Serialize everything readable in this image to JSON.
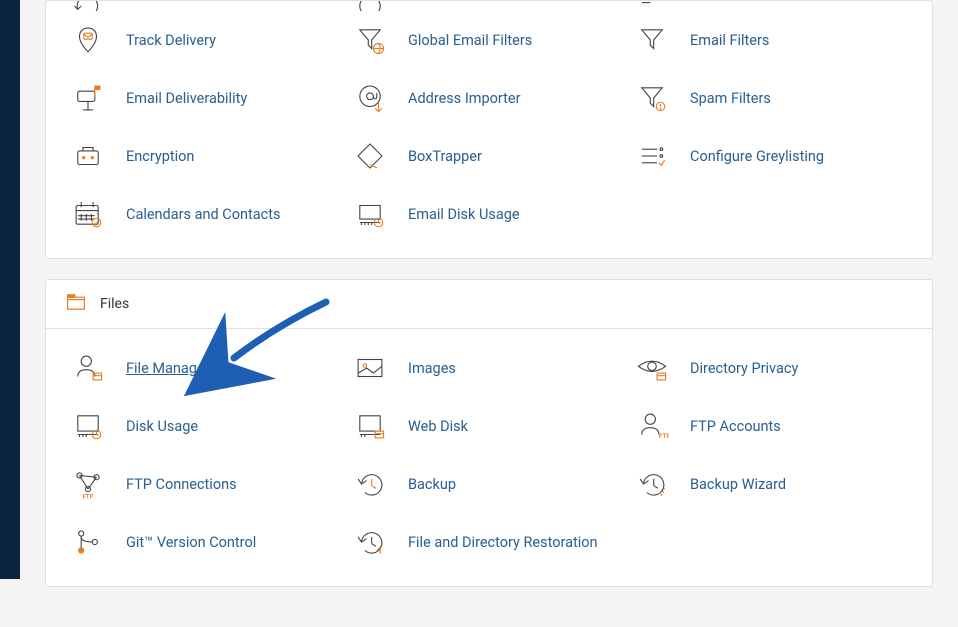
{
  "email": {
    "items": [
      {
        "label": "Track Delivery",
        "icon": "pin"
      },
      {
        "label": "Global Email Filters",
        "icon": "funnel-globe"
      },
      {
        "label": "Email Filters",
        "icon": "funnel"
      },
      {
        "label": "Email Deliverability",
        "icon": "mailbox"
      },
      {
        "label": "Address Importer",
        "icon": "at-import"
      },
      {
        "label": "Spam Filters",
        "icon": "funnel-alert"
      },
      {
        "label": "Encryption",
        "icon": "lock-box"
      },
      {
        "label": "BoxTrapper",
        "icon": "box-trap"
      },
      {
        "label": "Configure Greylisting",
        "icon": "list-check"
      },
      {
        "label": "Calendars and Contacts",
        "icon": "calendar-at"
      },
      {
        "label": "Email Disk Usage",
        "icon": "disk-mail"
      }
    ]
  },
  "files": {
    "header": "Files",
    "items": [
      {
        "label": "File Manager",
        "icon": "user-folder",
        "highlight": true
      },
      {
        "label": "Images",
        "icon": "image"
      },
      {
        "label": "Directory Privacy",
        "icon": "eye-lock"
      },
      {
        "label": "Disk Usage",
        "icon": "disk"
      },
      {
        "label": "Web Disk",
        "icon": "disk-web"
      },
      {
        "label": "FTP Accounts",
        "icon": "user-ftp"
      },
      {
        "label": "FTP Connections",
        "icon": "network-ftp"
      },
      {
        "label": "Backup",
        "icon": "clock-back"
      },
      {
        "label": "Backup Wizard",
        "icon": "clock-spark"
      },
      {
        "label": "Git™ Version Control",
        "icon": "git-branch"
      },
      {
        "label": "File and Directory Restoration",
        "icon": "clock-restore"
      }
    ]
  }
}
